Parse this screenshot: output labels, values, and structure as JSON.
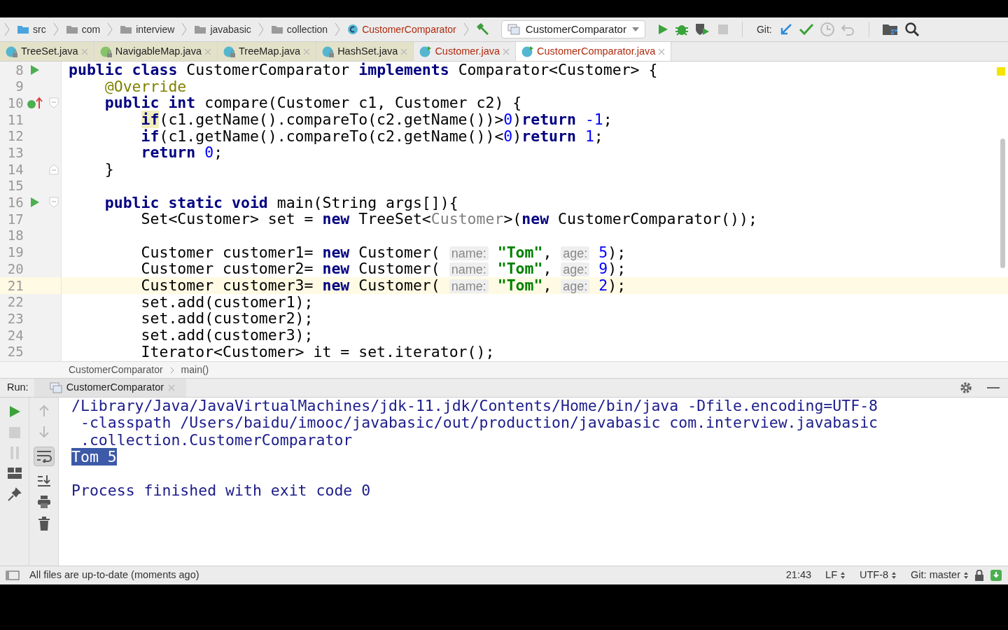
{
  "breadcrumbs": [
    {
      "label": "src",
      "kind": "source"
    },
    {
      "label": "com",
      "kind": "package"
    },
    {
      "label": "interview",
      "kind": "package"
    },
    {
      "label": "javabasic",
      "kind": "package"
    },
    {
      "label": "collection",
      "kind": "package"
    },
    {
      "label": "CustomerComparator",
      "kind": "class"
    }
  ],
  "run_config": "CustomerComparator",
  "git_label": "Git:",
  "tabs": [
    {
      "label": "TreeSet.java",
      "kind": "class",
      "locked": true,
      "modified": false,
      "selected": false
    },
    {
      "label": "NavigableMap.java",
      "kind": "interface",
      "locked": true,
      "modified": false,
      "selected": false
    },
    {
      "label": "TreeMap.java",
      "kind": "class",
      "locked": true,
      "modified": false,
      "selected": false
    },
    {
      "label": "HashSet.java",
      "kind": "class",
      "locked": true,
      "modified": false,
      "selected": false
    },
    {
      "label": "Customer.java",
      "kind": "class",
      "locked": false,
      "modified": true,
      "selected": false
    },
    {
      "label": "CustomerComparator.java",
      "kind": "class",
      "locked": false,
      "modified": true,
      "selected": true
    }
  ],
  "editor": {
    "lines": [
      {
        "number": "8",
        "current": false,
        "run_marker": true,
        "tokens": [
          {
            "kind": "kw",
            "text": "public class"
          },
          {
            "kind": "plain",
            "text": " CustomerComparator "
          },
          {
            "kind": "kw",
            "text": "implements"
          },
          {
            "kind": "plain",
            "text": " Comparator<Customer> {"
          }
        ]
      },
      {
        "number": "9",
        "current": false,
        "tokens": [
          {
            "kind": "ann",
            "text": "    @Override"
          }
        ]
      },
      {
        "number": "10",
        "current": false,
        "implements_marker": true,
        "fold_start": true,
        "tokens": [
          {
            "kind": "kw",
            "text": "    public int"
          },
          {
            "kind": "plain",
            "text": " compare(Customer c1, Customer c2) {"
          }
        ]
      },
      {
        "number": "11",
        "current": false,
        "tokens": [
          {
            "kind": "kwmark",
            "text": "        if"
          },
          {
            "kind": "plain",
            "text": "(c1.getName().compareTo(c2.getName())>"
          },
          {
            "kind": "num",
            "text": "0"
          },
          {
            "kind": "plain",
            "text": ")"
          },
          {
            "kind": "kw",
            "text": "return"
          },
          {
            "kind": "num",
            "text": " -1"
          },
          {
            "kind": "plain",
            "text": ";"
          }
        ]
      },
      {
        "number": "12",
        "current": false,
        "tokens": [
          {
            "kind": "kw",
            "text": "        if"
          },
          {
            "kind": "plain",
            "text": "(c1.getName().compareTo(c2.getName())<"
          },
          {
            "kind": "num",
            "text": "0"
          },
          {
            "kind": "plain",
            "text": ")"
          },
          {
            "kind": "kw",
            "text": "return"
          },
          {
            "kind": "num",
            "text": " 1"
          },
          {
            "kind": "plain",
            "text": ";"
          }
        ]
      },
      {
        "number": "13",
        "current": false,
        "tokens": [
          {
            "kind": "kw",
            "text": "        return"
          },
          {
            "kind": "num",
            "text": " 0"
          },
          {
            "kind": "plain",
            "text": ";"
          }
        ]
      },
      {
        "number": "14",
        "current": false,
        "fold_end": true,
        "tokens": [
          {
            "kind": "plain",
            "text": "    }"
          }
        ]
      },
      {
        "number": "15",
        "current": false
      },
      {
        "number": "16",
        "current": false,
        "run_marker": true,
        "fold_start": true,
        "tokens": [
          {
            "kind": "kw",
            "text": "    public static void"
          },
          {
            "kind": "plain",
            "text": " main(String args[]){"
          }
        ]
      },
      {
        "number": "17",
        "current": false,
        "tokens": [
          {
            "kind": "plain",
            "text": "        Set<Customer> set = "
          },
          {
            "kind": "kw",
            "text": "new"
          },
          {
            "kind": "plain",
            "text": " TreeSet<"
          },
          {
            "kind": "gray",
            "text": "Customer"
          },
          {
            "kind": "plain",
            "text": ">("
          },
          {
            "kind": "kw",
            "text": "new"
          },
          {
            "kind": "plain",
            "text": " CustomerComparator());"
          }
        ]
      },
      {
        "number": "18",
        "current": false
      },
      {
        "number": "19",
        "current": false,
        "tokens": [
          {
            "kind": "plain",
            "text": "        Customer customer1= "
          },
          {
            "kind": "kw",
            "text": "new"
          },
          {
            "kind": "plain",
            "text": " Customer( "
          },
          {
            "kind": "hint",
            "text": "name:"
          },
          {
            "kind": "str",
            "text": " \"Tom\""
          },
          {
            "kind": "plain",
            "text": ", "
          },
          {
            "kind": "hint",
            "text": "age:"
          },
          {
            "kind": "num",
            "text": " 5"
          },
          {
            "kind": "plain",
            "text": ");"
          }
        ]
      },
      {
        "number": "20",
        "current": false,
        "tokens": [
          {
            "kind": "plain",
            "text": "        Customer customer2= "
          },
          {
            "kind": "kw",
            "text": "new"
          },
          {
            "kind": "plain",
            "text": " Customer( "
          },
          {
            "kind": "hint",
            "text": "name:"
          },
          {
            "kind": "str",
            "text": " \"Tom\""
          },
          {
            "kind": "plain",
            "text": ", "
          },
          {
            "kind": "hint",
            "text": "age:"
          },
          {
            "kind": "num",
            "text": " 9"
          },
          {
            "kind": "plain",
            "text": ");"
          }
        ]
      },
      {
        "number": "21",
        "current": true,
        "tokens": [
          {
            "kind": "plain",
            "text": "        Customer customer3= "
          },
          {
            "kind": "kw",
            "text": "new"
          },
          {
            "kind": "plain",
            "text": " Customer( "
          },
          {
            "kind": "hint",
            "text": "name:"
          },
          {
            "kind": "str",
            "text": " \"Tom\""
          },
          {
            "kind": "plain",
            "text": ", "
          },
          {
            "kind": "hint",
            "text": "age:"
          },
          {
            "kind": "num",
            "text": " 2"
          },
          {
            "kind": "plain",
            "text": ");"
          }
        ]
      },
      {
        "number": "22",
        "current": false,
        "tokens": [
          {
            "kind": "plain",
            "text": "        set.add(customer1);"
          }
        ]
      },
      {
        "number": "23",
        "current": false,
        "tokens": [
          {
            "kind": "plain",
            "text": "        set.add(customer2);"
          }
        ]
      },
      {
        "number": "24",
        "current": false,
        "tokens": [
          {
            "kind": "plain",
            "text": "        set.add(customer3);"
          }
        ]
      },
      {
        "number": "25",
        "current": false,
        "tokens": [
          {
            "kind": "plain",
            "text": "        Iterator<Customer> it = set.iterator();"
          }
        ]
      }
    ],
    "breadcrumb": [
      "CustomerComparator",
      "main()"
    ]
  },
  "run": {
    "label": "Run:",
    "tab": "CustomerComparator",
    "output": [
      {
        "kind": "cmd",
        "text": "/Library/Java/JavaVirtualMachines/jdk-11.jdk/Contents/Home/bin/java -Dfile.encoding=UTF-8"
      },
      {
        "kind": "cmd",
        "text": " -classpath /Users/baidu/imooc/javabasic/out/production/javabasic com.interview.javabasic"
      },
      {
        "kind": "cmd",
        "text": " .collection.CustomerComparator"
      },
      {
        "kind": "selected",
        "text": "Tom 5"
      },
      {
        "kind": "blank"
      },
      {
        "kind": "cmd",
        "text": "Process finished with exit code 0"
      }
    ]
  },
  "status_bar": {
    "message": "All files are up-to-date (moments ago)",
    "position": "21:43",
    "line_separator": "LF",
    "encoding": "UTF-8",
    "vcs": "Git: master"
  }
}
